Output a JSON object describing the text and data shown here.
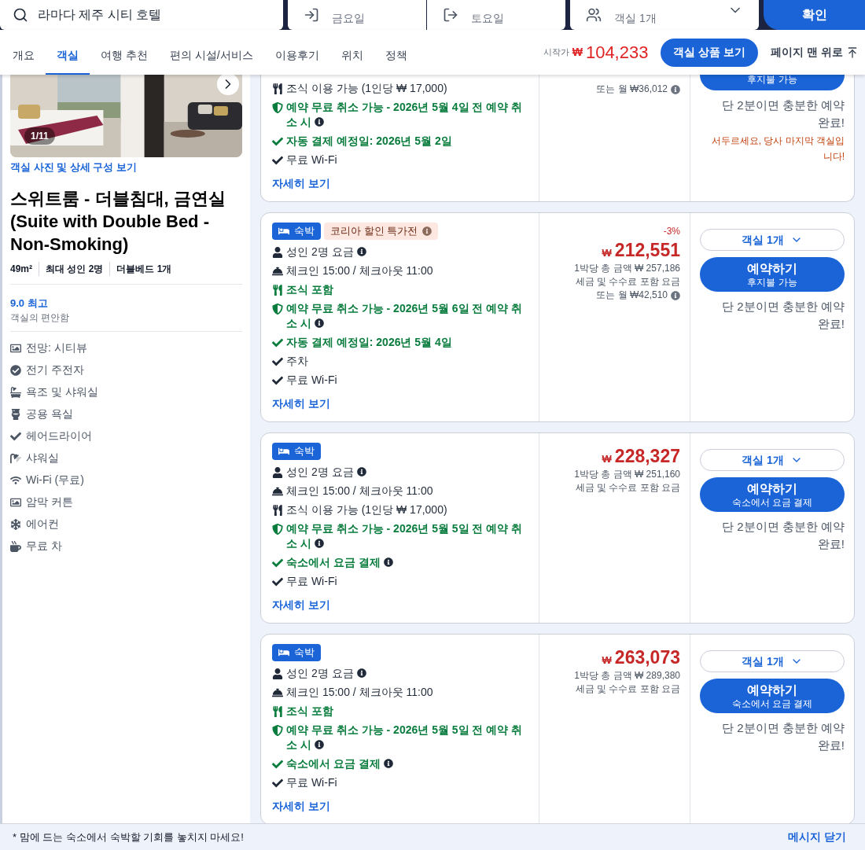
{
  "search_bar": {
    "destination": "라마다 제주 시티 호텔",
    "check_in": "금요일",
    "check_out": "토요일",
    "guests": "객실 1개",
    "button": "확인"
  },
  "nav": {
    "tabs": [
      {
        "label": "개요",
        "selected": false
      },
      {
        "label": "객실",
        "selected": true
      },
      {
        "label": "여행 추천",
        "selected": false
      },
      {
        "label": "편의 시설/서비스",
        "selected": false
      },
      {
        "label": "이용후기",
        "selected": false
      },
      {
        "label": "위치",
        "selected": false
      },
      {
        "label": "정책",
        "selected": false
      }
    ],
    "price_prefix": "시작가",
    "currency": "₩",
    "price": "104,233",
    "rooms_button": "객실 상품 보기",
    "top_link": "페이지 맨 위로"
  },
  "room": {
    "photo_counter": "1/11",
    "photos_link": "객실 사진 및 상세 구성 보기",
    "title": "스위트룸 - 더블침대, 금연실 (Suite with Double Bed - Non-Smoking)",
    "specs": [
      "49m²",
      "최대 성인 2명",
      "더블베드 1개"
    ],
    "rating": "9.0 최고",
    "rating_label": "객실의 편안함",
    "amenities": [
      {
        "kind": "view",
        "text": "전망: 시티뷰"
      },
      {
        "kind": "check_circle",
        "text": "전기 주전자"
      },
      {
        "kind": "bath",
        "text": "욕조 및 샤워실"
      },
      {
        "kind": "toilet",
        "text": "공용 욕실"
      },
      {
        "kind": "check",
        "text": "헤어드라이어"
      },
      {
        "kind": "shower",
        "text": "샤워실"
      },
      {
        "kind": "wifi",
        "text": "Wi-Fi (무료)"
      },
      {
        "kind": "view",
        "text": "암막 커튼"
      },
      {
        "kind": "aircon",
        "text": "에어컨"
      },
      {
        "kind": "tea",
        "text": "무료 차"
      }
    ]
  },
  "offers": [
    {
      "cut_top": true,
      "features": [
        {
          "kind": "meal",
          "text": "조식 이용 가능 (1인당 ₩ 17,000)",
          "highlight": false,
          "info": false
        },
        {
          "kind": "cancel",
          "text": "예약 무료 취소 가능 - 2026년 5월 4일 전 예약 취소 시",
          "highlight": true,
          "info": true
        },
        {
          "kind": "check",
          "text": "자동 결제 예정일: 2026년 5월 2일",
          "highlight": true,
          "info": false
        },
        {
          "kind": "check",
          "text": "무료 Wi-Fi",
          "highlight": false,
          "info": false
        }
      ],
      "details_link": "자세히 보기",
      "price_lines": [
        {
          "text": "또는 월 ₩36,012",
          "info": true
        }
      ],
      "book_sub": "후지불 가능",
      "note": "단 2분이면 충분한 예약 완료!",
      "urgency": "서두르세요, 당사 마지막 객실입니다!"
    },
    {
      "cut_top": false,
      "tags": [
        {
          "kind": "stay",
          "text": "숙박"
        },
        {
          "kind": "promo",
          "text": "코리아 할인 특가전"
        }
      ],
      "features": [
        {
          "kind": "adults",
          "text": "성인 2명 요금",
          "highlight": false,
          "info": true
        },
        {
          "kind": "checkin",
          "text": "체크인 15:00 / 체크아웃 11:00",
          "highlight": false,
          "info": false
        },
        {
          "kind": "meal",
          "text": "조식 포함",
          "highlight": true,
          "info": false
        },
        {
          "kind": "cancel",
          "text": "예약 무료 취소 가능 - 2026년 5월 6일 전 예약 취소 시",
          "highlight": true,
          "info": true
        },
        {
          "kind": "check",
          "text": "자동 결제 예정일: 2026년 5월 4일",
          "highlight": true,
          "info": false
        },
        {
          "kind": "check",
          "text": "주차",
          "highlight": false,
          "info": false
        },
        {
          "kind": "check",
          "text": "무료 Wi-Fi",
          "highlight": false,
          "info": false
        }
      ],
      "details_link": "자세히 보기",
      "discount": "-3%",
      "currency": "₩",
      "price": "212,551",
      "price_lines": [
        {
          "text": "1박당 총 금액 ₩ 257,186",
          "info": false
        },
        {
          "text": "세금 및 수수료 포함 요금",
          "info": false
        },
        {
          "text": "또는 월 ₩42,510",
          "info": true
        }
      ],
      "room_select": "객실 1개",
      "book": "예약하기",
      "book_sub": "후지불 가능",
      "note": "단 2분이면 충분한 예약 완료!"
    },
    {
      "cut_top": false,
      "tags": [
        {
          "kind": "stay",
          "text": "숙박"
        }
      ],
      "features": [
        {
          "kind": "adults",
          "text": "성인 2명 요금",
          "highlight": false,
          "info": true
        },
        {
          "kind": "checkin",
          "text": "체크인 15:00 / 체크아웃 11:00",
          "highlight": false,
          "info": false
        },
        {
          "kind": "meal",
          "text": "조식 이용 가능 (1인당 ₩ 17,000)",
          "highlight": false,
          "info": false
        },
        {
          "kind": "cancel",
          "text": "예약 무료 취소 가능 - 2026년 5월 5일 전 예약 취소 시",
          "highlight": true,
          "info": true
        },
        {
          "kind": "check",
          "text": "숙소에서 요금 결제",
          "highlight": true,
          "info": true
        },
        {
          "kind": "check",
          "text": "무료 Wi-Fi",
          "highlight": false,
          "info": false
        }
      ],
      "details_link": "자세히 보기",
      "currency": "₩",
      "price": "228,327",
      "price_lines": [
        {
          "text": "1박당 총 금액 ₩ 251,160",
          "info": false
        },
        {
          "text": "세금 및 수수료 포함 요금",
          "info": false
        }
      ],
      "room_select": "객실 1개",
      "book": "예약하기",
      "book_sub": "숙소에서 요금 결제",
      "note": "단 2분이면 충분한 예약 완료!"
    },
    {
      "cut_top": false,
      "tags": [
        {
          "kind": "stay",
          "text": "숙박"
        }
      ],
      "features": [
        {
          "kind": "adults",
          "text": "성인 2명 요금",
          "highlight": false,
          "info": true
        },
        {
          "kind": "checkin",
          "text": "체크인 15:00 / 체크아웃 11:00",
          "highlight": false,
          "info": false
        },
        {
          "kind": "meal",
          "text": "조식 포함",
          "highlight": true,
          "info": false
        },
        {
          "kind": "cancel",
          "text": "예약 무료 취소 가능 - 2026년 5월 5일 전 예약 취소 시",
          "highlight": true,
          "info": true
        },
        {
          "kind": "check",
          "text": "숙소에서 요금 결제",
          "highlight": true,
          "info": true
        },
        {
          "kind": "check",
          "text": "무료 Wi-Fi",
          "highlight": false,
          "info": false
        }
      ],
      "details_link": "자세히 보기",
      "currency": "₩",
      "price": "263,073",
      "price_lines": [
        {
          "text": "1박당 총 금액 ₩ 289,380",
          "info": false
        },
        {
          "text": "세금 및 수수료 포함 요금",
          "info": false
        }
      ],
      "room_select": "객실 1개",
      "book": "예약하기",
      "book_sub": "숙소에서 요금 결제",
      "note": "단 2분이면 충분한 예약 완료!"
    }
  ],
  "message_bar": {
    "text": "* 맘에 드는 숙소에서 숙박할 기회를 놓치지 마세요!",
    "close": "메시지 닫기"
  }
}
